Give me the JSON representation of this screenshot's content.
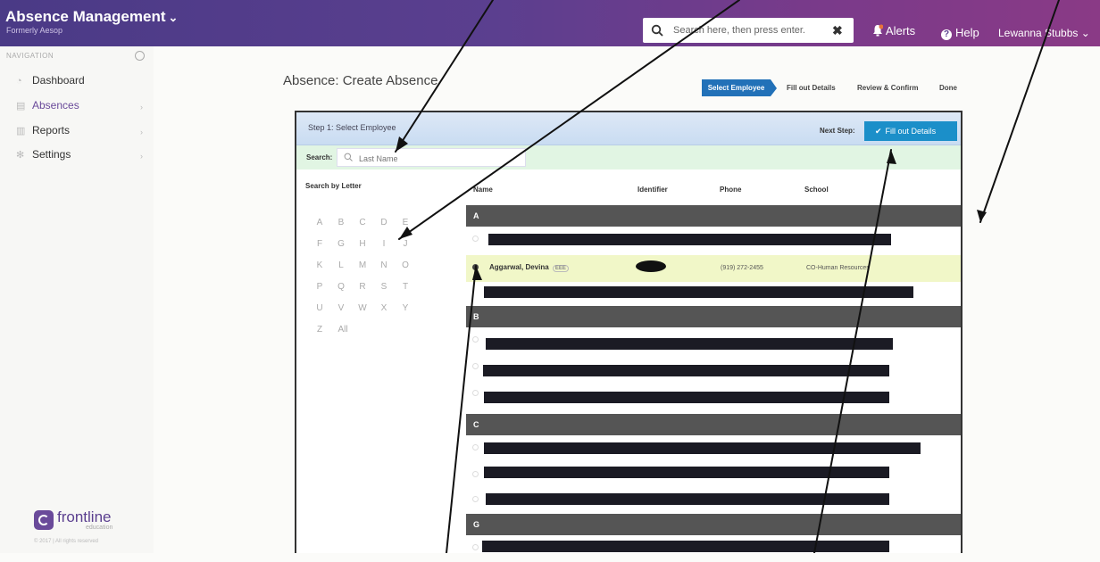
{
  "topbar": {
    "app_title": "Absence Management",
    "app_subtitle": "Formerly Aesop",
    "search_placeholder": "Search here, then press enter.",
    "alerts_label": "Alerts",
    "help_label": "Help",
    "user_name": "Lewanna Stubbs"
  },
  "sidebar": {
    "header": "NAVIGATION",
    "items": [
      {
        "label": "Dashboard",
        "icon": "dashboard-icon"
      },
      {
        "label": "Absences",
        "icon": "calendar-icon"
      },
      {
        "label": "Reports",
        "icon": "chart-icon"
      },
      {
        "label": "Settings",
        "icon": "gear-icon"
      }
    ],
    "brand_name": "frontline",
    "brand_tag": "education",
    "copyright": "© 2017 | All rights reserved"
  },
  "page": {
    "title": "Absence: Create Absence",
    "steps": [
      "Select Employee",
      "Fill out Details",
      "Review & Confirm",
      "Done"
    ]
  },
  "panel": {
    "step_title": "Step 1: Select Employee",
    "next_step_label": "Next Step:",
    "next_button": "Fill out Details",
    "search_label": "Search:",
    "search_placeholder": "Last Name",
    "search_by_letter": "Search by Letter",
    "letters": [
      "A",
      "B",
      "C",
      "D",
      "E",
      "F",
      "G",
      "H",
      "I",
      "J",
      "K",
      "L",
      "M",
      "N",
      "O",
      "P",
      "Q",
      "R",
      "S",
      "T",
      "U",
      "V",
      "W",
      "X",
      "Y",
      "Z",
      "All"
    ],
    "columns": [
      "Name",
      "Identifier",
      "Phone",
      "School"
    ],
    "groups": [
      "A",
      "B",
      "C",
      "G"
    ],
    "selected_employee": {
      "name": "Aggarwal, Devina",
      "badge": "EEE",
      "phone": "(919) 272-2455",
      "school": "CO-Human Resources"
    }
  },
  "colors": {
    "topbar_start": "#4a3a86",
    "topbar_end": "#8a3a86",
    "accent_blue": "#2271b8",
    "button_blue": "#1b8fc9",
    "group_header": "#555555",
    "selected_row": "#f1f7c8",
    "search_row": "#e1f5e3"
  }
}
